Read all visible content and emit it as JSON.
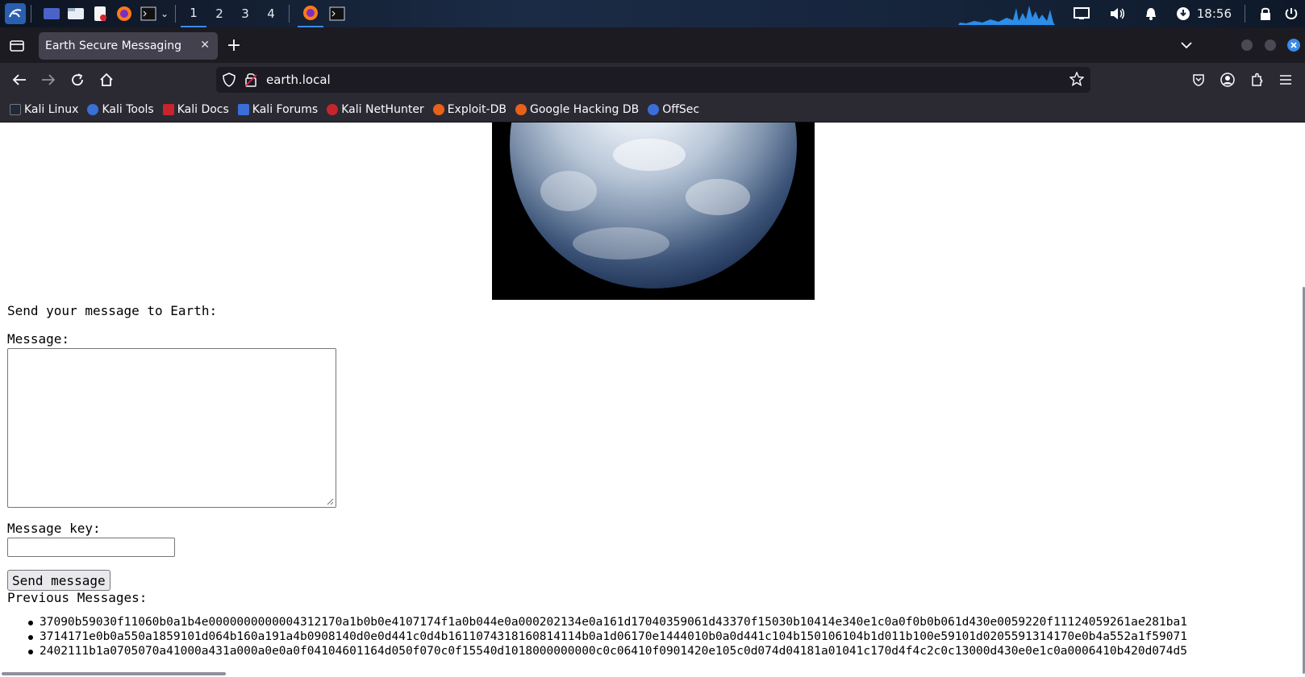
{
  "taskbar": {
    "workspaces": [
      "1",
      "2",
      "3",
      "4"
    ],
    "active_workspace": "1",
    "clock": "18:56",
    "icons": [
      "kali-menu-icon",
      "desktop-icon",
      "file-manager-icon",
      "text-editor-icon",
      "firefox-icon",
      "terminal-icon"
    ]
  },
  "browser": {
    "tab_title": "Earth Secure Messaging",
    "url": "earth.local",
    "bookmarks": [
      "Kali Linux",
      "Kali Tools",
      "Kali Docs",
      "Kali Forums",
      "Kali NetHunter",
      "Exploit-DB",
      "Google Hacking DB",
      "OffSec"
    ]
  },
  "page": {
    "intro": "Send your message to Earth:",
    "message_label": "Message:",
    "message_value": "",
    "key_label": "Message key:",
    "key_value": "",
    "send_label": "Send message",
    "previous_label": "Previous Messages:",
    "messages": [
      "37090b59030f11060b0a1b4e0000000000004312170a1b0b0e4107174f1a0b044e0a000202134e0a161d17040359061d43370f15030b10414e340e1c0a0f0b0b061d430e0059220f11124059261ae281ba1",
      "3714171e0b0a550a1859101d064b160a191a4b0908140d0e0d441c0d4b1611074318160814114b0a1d06170e1444010b0a0d441c104b150106104b1d011b100e59101d0205591314170e0b4a552a1f59071",
      "2402111b1a0705070a41000a431a000a0e0a0f04104601164d050f070c0f15540d1018000000000c0c06410f0901420e105c0d074d04181a01041c170d4f4c2c0c13000d430e0e1c0a0006410b420d074d5"
    ]
  },
  "colors": {
    "taskbar_bg": "#16253c",
    "tabbar_bg": "#1c1b22",
    "toolbar_bg": "#2b2a33",
    "active_workspace": "#3c8ae6"
  }
}
